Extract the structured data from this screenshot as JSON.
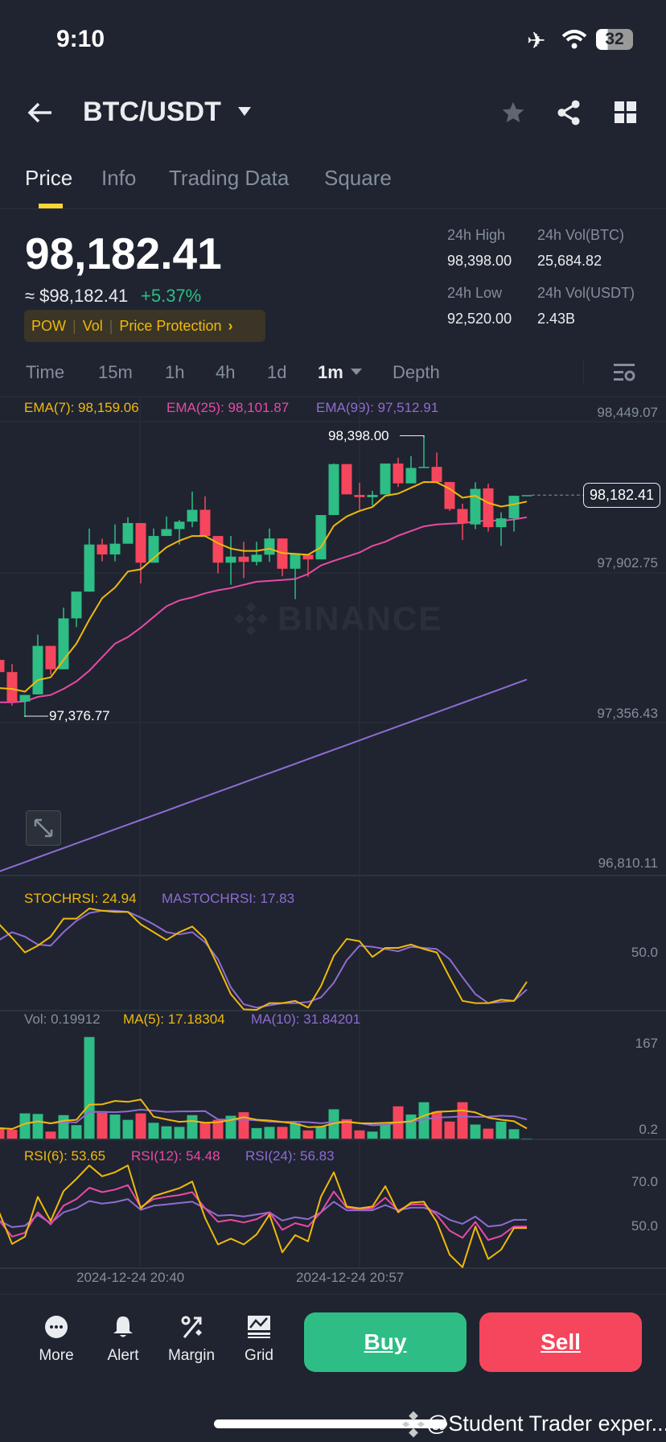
{
  "status_bar": {
    "time": "9:10",
    "battery": "32"
  },
  "header": {
    "pair": "BTC/USDT"
  },
  "tabs": [
    {
      "label": "Price"
    },
    {
      "label": "Info"
    },
    {
      "label": "Trading Data"
    },
    {
      "label": "Square"
    }
  ],
  "ticker": {
    "price": "98,182.41",
    "fiat_price": "≈ $98,182.41",
    "change": "+5.37%",
    "tags": [
      "POW",
      "Vol",
      "Price Protection"
    ],
    "stats": [
      {
        "label": "24h High",
        "value": "98,398.00"
      },
      {
        "label": "24h Vol(BTC)",
        "value": "25,684.82"
      },
      {
        "label": "24h Low",
        "value": "92,520.00"
      },
      {
        "label": "24h Vol(USDT)",
        "value": "2.43B"
      }
    ]
  },
  "timeframes": [
    {
      "label": "Time"
    },
    {
      "label": "15m"
    },
    {
      "label": "1h"
    },
    {
      "label": "4h"
    },
    {
      "label": "1d"
    },
    {
      "label": "1m"
    },
    {
      "label": "Depth"
    }
  ],
  "colors": {
    "up": "#2ebd85",
    "down": "#f6465d",
    "ema7": "#f0b90b",
    "ema25": "#e84aa6",
    "ema99": "#8f6cd1",
    "accent": "#fcd535"
  },
  "chart_data": [
    {
      "type": "candlestick",
      "title": "BTC/USDT 1m",
      "legend": {
        "ema7": "EMA(7): 98,159.06",
        "ema25": "EMA(25): 98,101.87",
        "ema99": "EMA(99): 97,512.91"
      },
      "y_ticks": [
        "98,449.07",
        "97,902.75",
        "97,356.43",
        "96,810.11"
      ],
      "y_tick_values": [
        98449.07,
        97902.75,
        97356.43,
        96810.11
      ],
      "x_ticks": [
        "2024-12-24 20:40",
        "2024-12-24 20:57"
      ],
      "high_label": "98,398.00",
      "low_label": "97,376.77",
      "current_price_label": "98,182.41",
      "current_price": 98182.41,
      "watermark": "BINANCE",
      "ohlc": [
        [
          97584,
          97600,
          97540,
          97540
        ],
        [
          97540,
          97569,
          97418,
          97433
        ],
        [
          97433,
          97457,
          97377,
          97457
        ],
        [
          97459,
          97676,
          97459,
          97635
        ],
        [
          97635,
          97635,
          97530,
          97550
        ],
        [
          97550,
          97774,
          97550,
          97735
        ],
        [
          97735,
          97832,
          97703,
          97832
        ],
        [
          97832,
          98061,
          97832,
          98003
        ],
        [
          98003,
          98024,
          97942,
          97967
        ],
        [
          97967,
          98076,
          97942,
          98006
        ],
        [
          98006,
          98102,
          98006,
          98081
        ],
        [
          98081,
          98081,
          97862,
          97937
        ],
        [
          97937,
          98061,
          97937,
          98034
        ],
        [
          98034,
          98105,
          98034,
          98059
        ],
        [
          98059,
          98092,
          98003,
          98086
        ],
        [
          98086,
          98195,
          98066,
          98129
        ],
        [
          98129,
          98178,
          98034,
          98034
        ],
        [
          98034,
          98034,
          97898,
          97937
        ],
        [
          97937,
          98034,
          97857,
          97959
        ],
        [
          97959,
          98013,
          97881,
          97940
        ],
        [
          97940,
          98013,
          97927,
          97966
        ],
        [
          97966,
          98061,
          97940,
          98025
        ],
        [
          98025,
          98025,
          97888,
          97915
        ],
        [
          97915,
          97969,
          97805,
          97969
        ],
        [
          97966,
          97966,
          97886,
          97949
        ],
        [
          97949,
          98110,
          97949,
          98110
        ],
        [
          98110,
          98297,
          98110,
          98295
        ],
        [
          98295,
          98295,
          98185,
          98185
        ],
        [
          98183,
          98227,
          98129,
          98175
        ],
        [
          98175,
          98198,
          98144,
          98183
        ],
        [
          98185,
          98297,
          98185,
          98297
        ],
        [
          98297,
          98318,
          98212,
          98225
        ],
        [
          98225,
          98324,
          98225,
          98281
        ],
        [
          98281,
          98398,
          98281,
          98285
        ],
        [
          98285,
          98337,
          98230,
          98230
        ],
        [
          98230,
          98230,
          98125,
          98132
        ],
        [
          98132,
          98151,
          98019,
          98081
        ],
        [
          98076,
          98229,
          98059,
          98205
        ],
        [
          98207,
          98224,
          98050,
          98066
        ],
        [
          98066,
          98120,
          97998,
          98098
        ],
        [
          98098,
          98180,
          98050,
          98180
        ],
        [
          98180,
          98182,
          98180,
          98182.41
        ]
      ],
      "ema7": [
        97482,
        97479,
        97469,
        97511,
        97521,
        97584,
        97643,
        97730,
        97808,
        97847,
        97905,
        97913,
        97954,
        97993,
        98017,
        98034,
        98034,
        98008,
        97988,
        97980,
        97980,
        97988,
        97972,
        97969,
        97966,
        97993,
        98071,
        98105,
        98125,
        98139,
        98180,
        98188,
        98209,
        98230,
        98229,
        98205,
        98173,
        98180,
        98154,
        98141,
        98149,
        98159
      ],
      "ema25": [
        97430,
        97430,
        97433,
        97450,
        97457,
        97479,
        97506,
        97545,
        97594,
        97643,
        97667,
        97701,
        97740,
        97779,
        97800,
        97811,
        97826,
        97837,
        97845,
        97857,
        97868,
        97871,
        97874,
        97878,
        97896,
        97927,
        97944,
        97959,
        97974,
        97998,
        98013,
        98035,
        98052,
        98069,
        98076,
        98079,
        98081,
        98086,
        98091,
        98089,
        98094,
        98102
      ],
      "ema99": [
        96816,
        96833,
        96850,
        96867,
        96884,
        96901,
        96918,
        96935,
        96952,
        96969,
        96986,
        97003,
        97020,
        97037,
        97054,
        97071,
        97088,
        97105,
        97122,
        97139,
        97156,
        97173,
        97190,
        97207,
        97224,
        97241,
        97258,
        97275,
        97292,
        97309,
        97326,
        97343,
        97360,
        97377,
        97394,
        97411,
        97428,
        97445,
        97462,
        97479,
        97496,
        97513
      ]
    },
    {
      "type": "line",
      "title": "StochRSI",
      "legend": {
        "k": "STOCHRSI: 24.94",
        "d": "MASTOCHRSI: 17.83"
      },
      "y_ticks": [
        "50.0"
      ],
      "ylim": [
        0,
        100
      ],
      "k": [
        76,
        64,
        51,
        57,
        65,
        81,
        81,
        90,
        88,
        87,
        87,
        76,
        69,
        62,
        69,
        74,
        63,
        39,
        14,
        0.4,
        0,
        6,
        6,
        8,
        2,
        21,
        48,
        63,
        61,
        47,
        55,
        55,
        58,
        54,
        51,
        29,
        8,
        6,
        6,
        9,
        8,
        25
      ],
      "d": [
        62,
        69,
        65,
        58,
        57,
        69,
        79,
        86,
        88,
        88,
        87,
        82,
        76,
        69,
        67,
        69,
        60,
        45,
        20,
        5,
        2,
        4,
        6,
        6,
        7,
        11,
        24,
        44,
        57,
        56,
        54,
        52,
        56,
        55,
        54,
        45,
        29,
        14,
        6,
        7,
        8,
        18
      ]
    },
    {
      "type": "bar",
      "title": "Volume",
      "legend": {
        "vol": "Vol: 0.19912",
        "ma5": "MA(5): 17.18304",
        "ma10": "MA(10): 31.84201"
      },
      "y_ticks": [
        "167",
        "0.2"
      ],
      "ylim": [
        0,
        167
      ],
      "values": [
        18,
        15,
        43,
        42,
        12,
        40,
        23,
        173,
        44,
        41,
        32,
        43,
        27,
        21,
        20,
        40,
        27,
        32,
        39,
        45,
        18,
        20,
        20,
        26,
        14,
        21,
        50,
        33,
        14,
        12,
        25,
        55,
        41,
        62,
        46,
        29,
        62,
        24,
        17,
        29,
        16,
        0.2
      ]
    },
    {
      "type": "line",
      "title": "RSI",
      "legend": {
        "rsi6": "RSI(6): 53.65",
        "rsi12": "RSI(12): 54.48",
        "rsi24": "RSI(24): 56.83"
      },
      "y_ticks": [
        "70.0",
        "50.0"
      ],
      "rsi6": [
        56.7,
        42.4,
        45.7,
        63.7,
        52.8,
        66.3,
        71.8,
        77.9,
        73.0,
        74.8,
        77.9,
        58.5,
        64.0,
        65.8,
        67.6,
        70.6,
        54.2,
        42.2,
        44.8,
        42.2,
        46.7,
        55.7,
        38.6,
        46.4,
        43.6,
        63.7,
        74.8,
        59.3,
        58.5,
        59.3,
        68.5,
        56.7,
        61.1,
        61.5,
        52.4,
        37.6,
        31.9,
        50.3,
        35.6,
        39.8,
        49.6,
        49.6
      ],
      "rsi12": [
        53.0,
        45.7,
        47.5,
        56.7,
        51.2,
        59.7,
        62.7,
        67.8,
        65.8,
        67.0,
        69.0,
        59.1,
        62.7,
        63.7,
        64.5,
        65.8,
        58.5,
        52.4,
        53.3,
        52.1,
        53.6,
        56.7,
        48.8,
        51.8,
        50.3,
        56.7,
        66.1,
        58.8,
        58.1,
        58.5,
        63.3,
        57.6,
        60.3,
        60.3,
        55.5,
        48.4,
        45.2,
        52.4,
        44.2,
        46.0,
        50.3,
        50.3
      ],
      "rsi24": [
        53.0,
        50.0,
        50.6,
        55.5,
        51.8,
        56.7,
        58.5,
        61.8,
        60.6,
        61.3,
        62.7,
        57.8,
        59.7,
        60.3,
        60.9,
        61.5,
        58.5,
        55.2,
        55.5,
        54.8,
        55.7,
        56.7,
        53.0,
        54.5,
        53.6,
        56.7,
        61.5,
        57.6,
        57.6,
        57.6,
        60.0,
        57.6,
        58.8,
        58.8,
        56.7,
        53.3,
        51.5,
        54.8,
        50.3,
        50.9,
        53.3,
        53.3
      ]
    }
  ],
  "bottom_bar": {
    "items": [
      {
        "label": "More"
      },
      {
        "label": "Alert"
      },
      {
        "label": "Margin"
      },
      {
        "label": "Grid"
      }
    ],
    "buy": "Buy",
    "sell": "Sell"
  },
  "watermark_caption": "@Student Trader exper..."
}
